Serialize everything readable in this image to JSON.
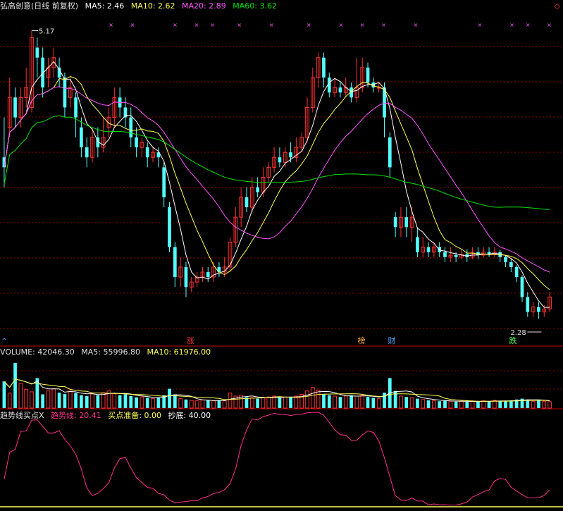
{
  "main_header": {
    "name": "弘高创意(日线 前复权)",
    "ma5_label": "MA5: 2.46",
    "ma10_label": "MA10: 2.62",
    "ma20_label": "MA20: 2.89",
    "ma60_label": "MA60: 3.62"
  },
  "volume_header": {
    "vol_label": "VOLUME: 42046.30",
    "ma5_label": "MA5: 55996.80",
    "ma10_label": "MA10: 61976.00"
  },
  "indicator_header": {
    "name": "趋势线买点X",
    "trend_label": "趋势线: 20.41",
    "buy_label": "买点准备: 0.00",
    "bottom_label": "抄底: 40.00"
  },
  "markers": {
    "high_label": "5.17",
    "low_label": "2.28",
    "zhang": "涨",
    "bang": "榜",
    "cai": "财",
    "die": "跌"
  },
  "colors": {
    "up": "#ff3232",
    "down": "#54ffff",
    "ma5": "#ffffff",
    "ma10": "#ffff54",
    "ma20": "#ff54ff",
    "ma60": "#00e600",
    "trend": "#ff2d8c",
    "buy": "#ffff54",
    "bottom": "#ffffff",
    "grid": "#8b0000"
  },
  "chart_data": [
    {
      "type": "candlestick",
      "name": "price",
      "y_range": [
        2.1,
        5.35
      ],
      "candles": [
        [
          3.9,
          3.8,
          4.3,
          3.6
        ],
        [
          4.2,
          4.5,
          4.7,
          4.1
        ],
        [
          4.5,
          4.3,
          4.6,
          4.2
        ],
        [
          4.3,
          4.5,
          4.6,
          4.2
        ],
        [
          4.5,
          4.6,
          4.8,
          4.4
        ],
        [
          4.4,
          5.1,
          5.17,
          4.35
        ],
        [
          5.0,
          4.9,
          5.1,
          4.7
        ],
        [
          4.9,
          4.6,
          5.0,
          4.5
        ],
        [
          4.7,
          4.8,
          4.9,
          4.6
        ],
        [
          4.8,
          4.9,
          5.0,
          4.7
        ],
        [
          4.8,
          4.7,
          4.9,
          4.6
        ],
        [
          4.7,
          4.4,
          4.75,
          4.3
        ],
        [
          4.5,
          4.6,
          4.7,
          4.4
        ],
        [
          4.5,
          4.3,
          4.55,
          4.1
        ],
        [
          4.2,
          4.0,
          4.3,
          3.9
        ],
        [
          4.0,
          3.9,
          4.1,
          3.8
        ],
        [
          3.9,
          4.1,
          4.2,
          3.85
        ],
        [
          4.1,
          4.0,
          4.2,
          3.9
        ],
        [
          4.0,
          4.1,
          4.3,
          3.95
        ],
        [
          4.2,
          4.3,
          4.4,
          4.1
        ],
        [
          4.3,
          4.5,
          4.6,
          4.2
        ],
        [
          4.5,
          4.4,
          4.6,
          4.3
        ],
        [
          4.4,
          4.3,
          4.5,
          4.2
        ],
        [
          4.3,
          4.1,
          4.4,
          4.0
        ],
        [
          4.1,
          4.0,
          4.2,
          3.9
        ],
        [
          4.0,
          4.05,
          4.1,
          3.9
        ],
        [
          4.0,
          3.9,
          4.05,
          3.8
        ],
        [
          3.9,
          3.95,
          4.0,
          3.85
        ],
        [
          3.95,
          3.9,
          4.0,
          3.8
        ],
        [
          3.8,
          3.5,
          3.85,
          3.4
        ],
        [
          3.4,
          3.0,
          3.45,
          2.95
        ],
        [
          3.0,
          2.7,
          3.05,
          2.6
        ],
        [
          2.7,
          2.8,
          2.9,
          2.6
        ],
        [
          2.8,
          2.6,
          2.85,
          2.5
        ],
        [
          2.6,
          2.65,
          2.7,
          2.55
        ],
        [
          2.65,
          2.7,
          2.75,
          2.6
        ],
        [
          2.7,
          2.75,
          2.8,
          2.65
        ],
        [
          2.75,
          2.7,
          2.8,
          2.65
        ],
        [
          2.7,
          2.8,
          2.85,
          2.65
        ],
        [
          2.8,
          2.75,
          2.85,
          2.7
        ],
        [
          2.75,
          2.8,
          2.9,
          2.7
        ],
        [
          2.8,
          3.05,
          3.1,
          2.75
        ],
        [
          3.05,
          3.3,
          3.4,
          3.0
        ],
        [
          3.3,
          3.5,
          3.6,
          3.2
        ],
        [
          3.5,
          3.4,
          3.6,
          3.35
        ],
        [
          3.4,
          3.6,
          3.7,
          3.35
        ],
        [
          3.6,
          3.55,
          3.7,
          3.5
        ],
        [
          3.55,
          3.7,
          3.8,
          3.5
        ],
        [
          3.7,
          3.8,
          3.85,
          3.65
        ],
        [
          3.8,
          3.9,
          4.0,
          3.75
        ],
        [
          3.9,
          3.85,
          4.0,
          3.8
        ],
        [
          3.85,
          3.95,
          4.0,
          3.8
        ],
        [
          3.95,
          3.9,
          4.05,
          3.85
        ],
        [
          3.9,
          4.0,
          4.1,
          3.85
        ],
        [
          4.0,
          4.1,
          4.15,
          3.95
        ],
        [
          4.1,
          4.4,
          4.5,
          4.05
        ],
        [
          4.4,
          4.7,
          4.8,
          4.35
        ],
        [
          4.7,
          4.9,
          4.95,
          4.6
        ],
        [
          4.9,
          4.7,
          4.95,
          4.6
        ],
        [
          4.7,
          4.55,
          4.75,
          4.5
        ],
        [
          4.55,
          4.6,
          4.7,
          4.5
        ],
        [
          4.6,
          4.55,
          4.65,
          4.5
        ],
        [
          4.55,
          4.6,
          4.7,
          4.5
        ],
        [
          4.6,
          4.5,
          4.65,
          4.45
        ],
        [
          4.5,
          4.6,
          4.9,
          4.45
        ],
        [
          4.6,
          4.8,
          4.9,
          4.55
        ],
        [
          4.8,
          4.65,
          4.85,
          4.6
        ],
        [
          4.65,
          4.6,
          4.7,
          4.55
        ],
        [
          4.6,
          4.6,
          4.65,
          4.55
        ],
        [
          4.6,
          4.3,
          4.65,
          4.1
        ],
        [
          4.1,
          3.8,
          4.15,
          3.7
        ],
        [
          3.3,
          3.2,
          3.35,
          3.1
        ],
        [
          3.2,
          3.3,
          3.4,
          3.1
        ],
        [
          3.3,
          3.2,
          3.4,
          3.1
        ],
        [
          3.2,
          3.3,
          3.4,
          3.05
        ],
        [
          3.1,
          2.95,
          3.2,
          2.9
        ],
        [
          2.95,
          3.0,
          3.1,
          2.9
        ],
        [
          3.0,
          2.95,
          3.05,
          2.9
        ],
        [
          2.95,
          3.0,
          3.05,
          2.9
        ],
        [
          3.0,
          2.95,
          3.05,
          2.9
        ],
        [
          2.95,
          2.9,
          3.0,
          2.85
        ],
        [
          2.9,
          2.92,
          3.0,
          2.85
        ],
        [
          2.92,
          2.9,
          2.95,
          2.85
        ],
        [
          2.9,
          2.93,
          2.98,
          2.88
        ],
        [
          2.93,
          2.9,
          2.98,
          2.85
        ],
        [
          2.9,
          2.95,
          3.0,
          2.88
        ],
        [
          2.95,
          2.92,
          3.0,
          2.88
        ],
        [
          2.92,
          2.95,
          3.0,
          2.9
        ],
        [
          2.95,
          2.93,
          3.0,
          2.9
        ],
        [
          2.93,
          2.95,
          3.0,
          2.9
        ],
        [
          2.95,
          2.9,
          2.97,
          2.85
        ],
        [
          2.9,
          2.85,
          2.92,
          2.8
        ],
        [
          2.85,
          2.8,
          2.88,
          2.75
        ],
        [
          2.8,
          2.7,
          2.82,
          2.65
        ],
        [
          2.7,
          2.5,
          2.72,
          2.45
        ],
        [
          2.5,
          2.35,
          2.55,
          2.3
        ],
        [
          2.35,
          2.4,
          2.45,
          2.3
        ],
        [
          2.4,
          2.35,
          2.45,
          2.28
        ],
        [
          2.35,
          2.38,
          2.42,
          2.3
        ],
        [
          2.38,
          2.5,
          2.55,
          2.35
        ]
      ],
      "high_value": 5.17,
      "low_value": 2.28
    },
    {
      "type": "bar",
      "name": "volume",
      "y_range": [
        0,
        120000
      ],
      "values": [
        62000,
        35000,
        105000,
        58000,
        44000,
        38000,
        70000,
        32000,
        40000,
        45000,
        36000,
        33000,
        40000,
        35000,
        30000,
        28000,
        35000,
        30000,
        36000,
        40000,
        34000,
        30000,
        32000,
        28000,
        25000,
        26000,
        24000,
        22000,
        25000,
        30000,
        45000,
        32000,
        22000,
        20000,
        18000,
        17000,
        19000,
        18000,
        17000,
        18000,
        17000,
        35000,
        28000,
        30000,
        25000,
        24000,
        22000,
        24000,
        26000,
        28000,
        24000,
        26000,
        25000,
        28000,
        32000,
        40000,
        48000,
        42000,
        32000,
        30000,
        28000,
        26000,
        28000,
        30000,
        28000,
        30000,
        26000,
        24000,
        22000,
        36000,
        70000,
        40000,
        28000,
        26000,
        24000,
        22000,
        20000,
        18000,
        17000,
        16000,
        17000,
        16000,
        15000,
        16000,
        15000,
        16000,
        15000,
        17000,
        16000,
        18000,
        17000,
        16000,
        18000,
        20000,
        22000,
        20000,
        16000,
        18000,
        16000,
        15000
      ]
    },
    {
      "type": "line",
      "name": "indicator",
      "y_range": [
        0,
        100
      ]
    }
  ]
}
